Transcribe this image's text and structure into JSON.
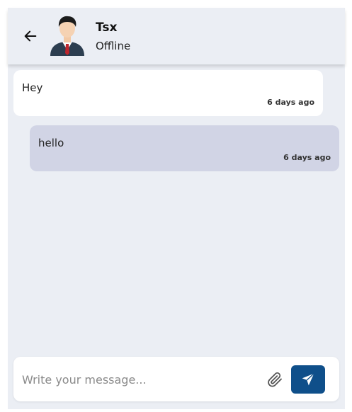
{
  "header": {
    "back_icon": "arrow-left-icon",
    "contact_name": "Tsx",
    "contact_status": "Offline",
    "avatar_icon": "businessman-avatar"
  },
  "messages": [
    {
      "direction": "incoming",
      "text": "Hey",
      "time": "6 days ago"
    },
    {
      "direction": "outgoing",
      "text": "hello",
      "time": "6 days ago"
    }
  ],
  "composer": {
    "placeholder": "Write your message...",
    "value": "",
    "attach_icon": "paperclip-icon",
    "send_icon": "send-icon"
  },
  "colors": {
    "background": "#ebeef4",
    "incoming_bubble": "#ffffff",
    "outgoing_bubble": "#d1d4e5",
    "send_button": "#0f4f8a"
  }
}
